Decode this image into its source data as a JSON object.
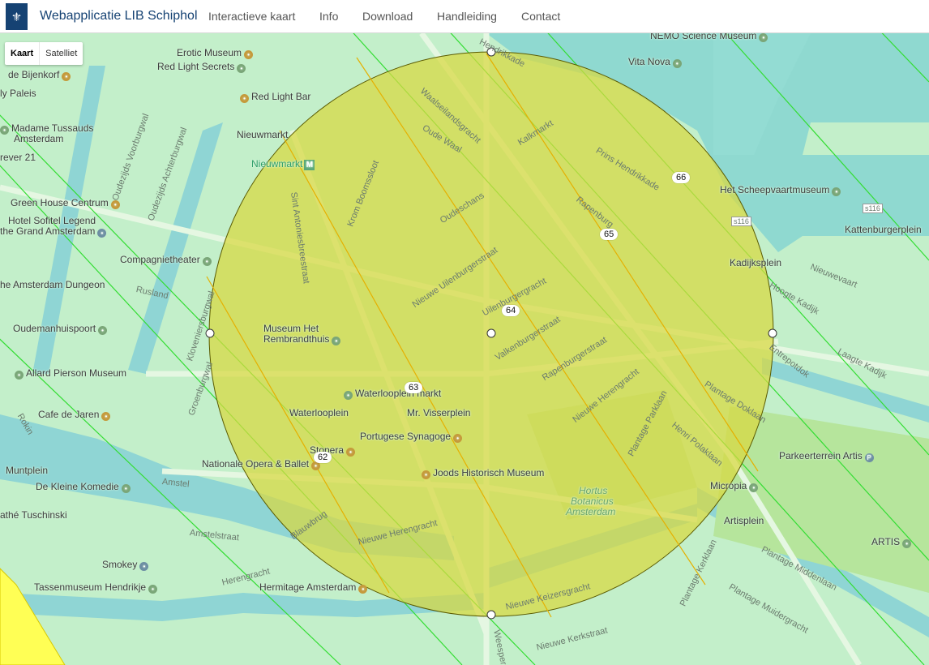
{
  "app": {
    "title": "Webapplicatie LIB Schiphol"
  },
  "nav": [
    {
      "label": "Interactieve kaart"
    },
    {
      "label": "Info"
    },
    {
      "label": "Download"
    },
    {
      "label": "Handleiding"
    },
    {
      "label": "Contact"
    }
  ],
  "map_type": {
    "map_label": "Kaart",
    "satellite_label": "Satelliet",
    "selected": "Kaart"
  },
  "colors": {
    "brand": "#154273",
    "circle_fill": "#d8d840",
    "contour_line": "#33dd33",
    "zone": "#ffff55"
  },
  "places": [
    {
      "label": "Erotic Museum",
      "icon": "shopping-icon"
    },
    {
      "label": "Red Light Secrets",
      "icon": "museum-icon"
    },
    {
      "label": "de Bijenkorf",
      "icon": "shopping-icon"
    },
    {
      "label": "Red Light Bar",
      "icon": "bar-icon"
    },
    {
      "label": "Madame Tussauds",
      "icon": "museum-icon"
    },
    {
      "label": "Amsterdam"
    },
    {
      "label": "Nieuwmarkt"
    },
    {
      "label": "Nieuwmarkt",
      "icon": "metro-icon"
    },
    {
      "label": "Green House Centrum",
      "icon": "shopping-icon"
    },
    {
      "label": "Hotel Sofitel Legend"
    },
    {
      "label": "the Grand Amsterdam",
      "icon": "hotel-icon"
    },
    {
      "label": "Compagnietheater",
      "icon": "theater-icon"
    },
    {
      "label": "he Amsterdam Dungeon"
    },
    {
      "label": "Oudemanhuispoort",
      "icon": "landmark-icon"
    },
    {
      "label": "Museum Het"
    },
    {
      "label": "Rembrandthuis",
      "icon": "museum-icon"
    },
    {
      "label": "Allard Pierson Museum",
      "icon": "museum-icon"
    },
    {
      "label": "Waterlooplein markt",
      "icon": "market-icon"
    },
    {
      "label": "Cafe de Jaren",
      "icon": "cafe-icon"
    },
    {
      "label": "Waterlooplein"
    },
    {
      "label": "Mr. Visserplein"
    },
    {
      "label": "Portugese Synagoge",
      "icon": "worship-icon"
    },
    {
      "label": "Stopera",
      "icon": "theater-icon"
    },
    {
      "label": "Nationale Opera & Ballet",
      "icon": "theater-icon"
    },
    {
      "label": "Joods Historisch Museum",
      "icon": "museum-icon"
    },
    {
      "label": "Muntplein"
    },
    {
      "label": "De Kleine Komedie",
      "icon": "theater-icon"
    },
    {
      "label": "athé Tuschinski",
      "icon": "cinema-icon"
    },
    {
      "label": "Smokey",
      "icon": "shopping-icon"
    },
    {
      "label": "Tassenmuseum Hendrikje",
      "icon": "museum-icon"
    },
    {
      "label": "Hermitage Amsterdam",
      "icon": "museum-icon"
    },
    {
      "label": "Hortus"
    },
    {
      "label": "Botanicus"
    },
    {
      "label": "Amsterdam"
    },
    {
      "label": "Micropia",
      "icon": "museum-icon"
    },
    {
      "label": "Artisplein"
    },
    {
      "label": "ARTIS",
      "icon": "zoo-icon"
    },
    {
      "label": "Parkeerterrein Artis",
      "icon": "parking-icon"
    },
    {
      "label": "Het Scheepvaartmuseum",
      "icon": "museum-icon"
    },
    {
      "label": "Kattenburgerplein"
    },
    {
      "label": "Kadijksplein"
    },
    {
      "label": "Vita Nova",
      "icon": "photo-icon"
    },
    {
      "label": "NEMO Science Museum",
      "icon": "museum-icon"
    },
    {
      "label": "ly Paleis"
    },
    {
      "label": "rever 21"
    }
  ],
  "streets": [
    {
      "label": "Oude Waal"
    },
    {
      "label": "Waalseilandsgracht"
    },
    {
      "label": "Kalkmarkt"
    },
    {
      "label": "Prins Hendrikkade"
    },
    {
      "label": "Oudeschans"
    },
    {
      "label": "Rapenburg"
    },
    {
      "label": "Nieuwe Uilenburgerstraat"
    },
    {
      "label": "Uilenburgergracht"
    },
    {
      "label": "Valkenburgerstraat"
    },
    {
      "label": "Rapenburgerstraat"
    },
    {
      "label": "Nieuwe Herengracht"
    },
    {
      "label": "Plantage Parklaan"
    },
    {
      "label": "Henri Polaklaan"
    },
    {
      "label": "Plantage Doklaan"
    },
    {
      "label": "Entrepotdok"
    },
    {
      "label": "Laagte Kadijk"
    },
    {
      "label": "Hoogte Kadijk"
    },
    {
      "label": "Nieuwevaart"
    },
    {
      "label": "Sint Antoniesbreestraat"
    },
    {
      "label": "Krom Boomssloot"
    },
    {
      "label": "Kloveniersburgwal"
    },
    {
      "label": "Groenburgwal"
    },
    {
      "label": "Oudezijds Achterburgwal"
    },
    {
      "label": "Oudezijds Voorburgwal"
    },
    {
      "label": "Rusland"
    },
    {
      "label": "Amstel"
    },
    {
      "label": "Amstelstraat"
    },
    {
      "label": "Herengracht"
    },
    {
      "label": "Blauwbrug"
    },
    {
      "label": "Nieuwe Herengracht"
    },
    {
      "label": "Nieuwe Keizersgracht"
    },
    {
      "label": "Nieuwe Kerkstraat"
    },
    {
      "label": "Weesperstraat"
    },
    {
      "label": "Plantage Kerklaan"
    },
    {
      "label": "Plantage Middenlaan"
    },
    {
      "label": "Plantage Muidergracht"
    },
    {
      "label": "Hendrikkade"
    },
    {
      "label": "Rokin"
    }
  ],
  "road_shields": [
    {
      "label": "s116"
    },
    {
      "label": "s116"
    }
  ],
  "contours": [
    {
      "value": "66"
    },
    {
      "value": "65"
    },
    {
      "value": "64"
    },
    {
      "value": "63"
    },
    {
      "value": "62"
    }
  ]
}
